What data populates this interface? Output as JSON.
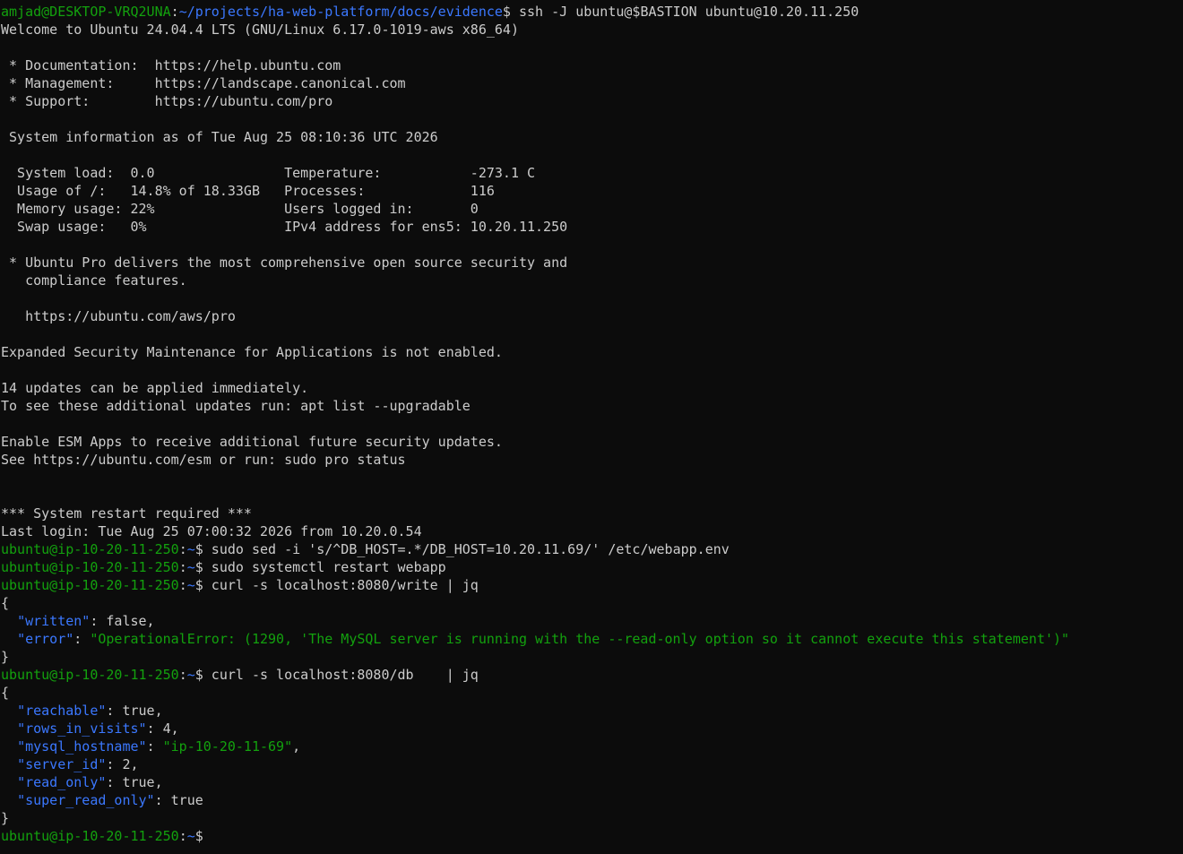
{
  "terminal": {
    "colors": {
      "background": "#0c0c0c",
      "text": "#cccccc",
      "prompt_user": "#13a10e",
      "prompt_path": "#3b78ff",
      "json_key": "#3b78ff",
      "json_string": "#13a10e"
    },
    "lines": [
      [
        {
          "t": "amjad@DESKTOP-VRQ2UNA",
          "c": "user"
        },
        {
          "t": ":",
          "c": "default"
        },
        {
          "t": "~/projects/ha-web-platform/docs/evidence",
          "c": "path"
        },
        {
          "t": "$ ssh -J ubuntu@$BASTION ubuntu@10.20.11.250",
          "c": "default"
        }
      ],
      [
        {
          "t": "Welcome to Ubuntu 24.04.4 LTS (GNU/Linux 6.17.0-1019-aws x86_64)",
          "c": "default"
        }
      ],
      [],
      [
        {
          "t": " * Documentation:  https://help.ubuntu.com",
          "c": "default"
        }
      ],
      [
        {
          "t": " * Management:     https://landscape.canonical.com",
          "c": "default"
        }
      ],
      [
        {
          "t": " * Support:        https://ubuntu.com/pro",
          "c": "default"
        }
      ],
      [],
      [
        {
          "t": " System information as of Tue Aug 25 08:10:36 UTC 2026",
          "c": "default"
        }
      ],
      [],
      [
        {
          "t": "  System load:  0.0                Temperature:           -273.1 C",
          "c": "default"
        }
      ],
      [
        {
          "t": "  Usage of /:   14.8% of 18.33GB   Processes:             116",
          "c": "default"
        }
      ],
      [
        {
          "t": "  Memory usage: 22%                Users logged in:       0",
          "c": "default"
        }
      ],
      [
        {
          "t": "  Swap usage:   0%                 IPv4 address for ens5: 10.20.11.250",
          "c": "default"
        }
      ],
      [],
      [
        {
          "t": " * Ubuntu Pro delivers the most comprehensive open source security and",
          "c": "default"
        }
      ],
      [
        {
          "t": "   compliance features.",
          "c": "default"
        }
      ],
      [],
      [
        {
          "t": "   https://ubuntu.com/aws/pro",
          "c": "default"
        }
      ],
      [],
      [
        {
          "t": "Expanded Security Maintenance for Applications is not enabled.",
          "c": "default"
        }
      ],
      [],
      [
        {
          "t": "14 updates can be applied immediately.",
          "c": "default"
        }
      ],
      [
        {
          "t": "To see these additional updates run: apt list --upgradable",
          "c": "default"
        }
      ],
      [],
      [
        {
          "t": "Enable ESM Apps to receive additional future security updates.",
          "c": "default"
        }
      ],
      [
        {
          "t": "See https://ubuntu.com/esm or run: sudo pro status",
          "c": "default"
        }
      ],
      [],
      [],
      [
        {
          "t": "*** System restart required ***",
          "c": "default"
        }
      ],
      [
        {
          "t": "Last login: Tue Aug 25 07:00:32 2026 from 10.20.0.54",
          "c": "default"
        }
      ],
      [
        {
          "t": "ubuntu@ip-10-20-11-250",
          "c": "user"
        },
        {
          "t": ":",
          "c": "default"
        },
        {
          "t": "~",
          "c": "path"
        },
        {
          "t": "$ sudo sed -i 's/^DB_HOST=.*/DB_HOST=10.20.11.69/' /etc/webapp.env",
          "c": "default"
        }
      ],
      [
        {
          "t": "ubuntu@ip-10-20-11-250",
          "c": "user"
        },
        {
          "t": ":",
          "c": "default"
        },
        {
          "t": "~",
          "c": "path"
        },
        {
          "t": "$ sudo systemctl restart webapp",
          "c": "default"
        }
      ],
      [
        {
          "t": "ubuntu@ip-10-20-11-250",
          "c": "user"
        },
        {
          "t": ":",
          "c": "default"
        },
        {
          "t": "~",
          "c": "path"
        },
        {
          "t": "$ curl -s localhost:8080/write | jq",
          "c": "default"
        }
      ],
      [
        {
          "t": "{",
          "c": "default"
        }
      ],
      [
        {
          "t": "  ",
          "c": "default"
        },
        {
          "t": "\"written\"",
          "c": "key"
        },
        {
          "t": ": false,",
          "c": "default"
        }
      ],
      [
        {
          "t": "  ",
          "c": "default"
        },
        {
          "t": "\"error\"",
          "c": "key"
        },
        {
          "t": ": ",
          "c": "default"
        },
        {
          "t": "\"OperationalError: (1290, 'The MySQL server is running with the --read-only option so it cannot execute this statement')\"",
          "c": "str"
        }
      ],
      [
        {
          "t": "}",
          "c": "default"
        }
      ],
      [
        {
          "t": "ubuntu@ip-10-20-11-250",
          "c": "user"
        },
        {
          "t": ":",
          "c": "default"
        },
        {
          "t": "~",
          "c": "path"
        },
        {
          "t": "$ curl -s localhost:8080/db    | jq",
          "c": "default"
        }
      ],
      [
        {
          "t": "{",
          "c": "default"
        }
      ],
      [
        {
          "t": "  ",
          "c": "default"
        },
        {
          "t": "\"reachable\"",
          "c": "key"
        },
        {
          "t": ": true,",
          "c": "default"
        }
      ],
      [
        {
          "t": "  ",
          "c": "default"
        },
        {
          "t": "\"rows_in_visits\"",
          "c": "key"
        },
        {
          "t": ": 4,",
          "c": "default"
        }
      ],
      [
        {
          "t": "  ",
          "c": "default"
        },
        {
          "t": "\"mysql_hostname\"",
          "c": "key"
        },
        {
          "t": ": ",
          "c": "default"
        },
        {
          "t": "\"ip-10-20-11-69\"",
          "c": "str"
        },
        {
          "t": ",",
          "c": "default"
        }
      ],
      [
        {
          "t": "  ",
          "c": "default"
        },
        {
          "t": "\"server_id\"",
          "c": "key"
        },
        {
          "t": ": 2,",
          "c": "default"
        }
      ],
      [
        {
          "t": "  ",
          "c": "default"
        },
        {
          "t": "\"read_only\"",
          "c": "key"
        },
        {
          "t": ": true,",
          "c": "default"
        }
      ],
      [
        {
          "t": "  ",
          "c": "default"
        },
        {
          "t": "\"super_read_only\"",
          "c": "key"
        },
        {
          "t": ": true",
          "c": "default"
        }
      ],
      [
        {
          "t": "}",
          "c": "default"
        }
      ]
    ],
    "current_prompt": {
      "user": "ubuntu@ip-10-20-11-250",
      "sep": ":",
      "path": "~",
      "symbol": "$"
    }
  }
}
